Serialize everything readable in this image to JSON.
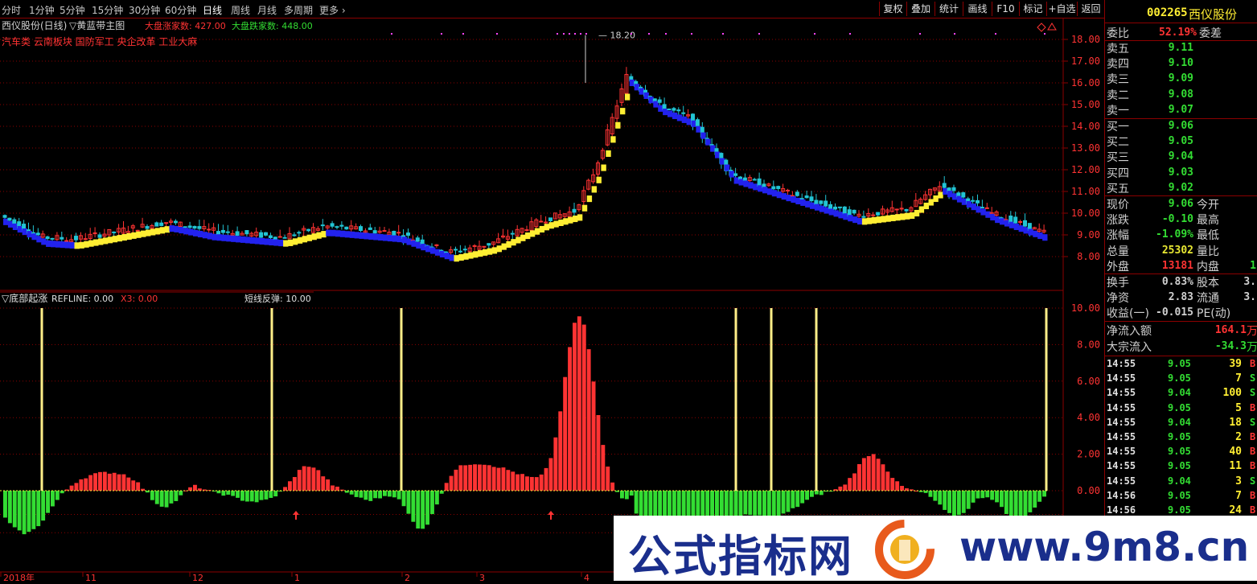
{
  "toolbar": {
    "periods": [
      "分时",
      "1分钟",
      "5分钟",
      "15分钟",
      "30分钟",
      "60分钟",
      "日线",
      "周线",
      "月线",
      "多周期",
      "更多"
    ],
    "active_period": "日线",
    "buttons": [
      "复权",
      "叠加",
      "统计",
      "画线",
      "F10",
      "标记",
      "+自选",
      "返回"
    ]
  },
  "main_panel": {
    "stock_label": "西仪股份(日线)",
    "indicator_label": "▽黄蓝带主图",
    "market_up_label": "大盘涨家数: 427.00",
    "market_down_label": "大盘跌家数: 448.00",
    "concepts": "汽车类 云南板块 国防军工 央企改革 工业大麻",
    "peak_label": "18.20",
    "y_ticks": [
      "18.00",
      "17.00",
      "16.00",
      "15.00",
      "14.00",
      "13.00",
      "12.00",
      "11.00",
      "10.00",
      "9.00",
      "8.00"
    ]
  },
  "sub_panel": {
    "name": "▽底部起涨",
    "refline": "REFLINE: 0.00",
    "x3": "X3: 0.00",
    "signal": "短线反弹: 10.00",
    "y_ticks": [
      "10.00",
      "8.00",
      "6.00",
      "4.00",
      "2.00",
      "0.00"
    ]
  },
  "x_axis": {
    "labels": [
      "2018年",
      "11",
      "12",
      "1",
      "2",
      "3",
      "4"
    ]
  },
  "quote": {
    "code": "002265",
    "name": "西仪股份",
    "weibi_label": "委比",
    "weibi_value": "52.19%",
    "weicha_label": "委差",
    "sell": [
      {
        "label": "卖五",
        "price": "9.11"
      },
      {
        "label": "卖四",
        "price": "9.10"
      },
      {
        "label": "卖三",
        "price": "9.09"
      },
      {
        "label": "卖二",
        "price": "9.08"
      },
      {
        "label": "卖一",
        "price": "9.07"
      }
    ],
    "buy": [
      {
        "label": "买一",
        "price": "9.06"
      },
      {
        "label": "买二",
        "price": "9.05"
      },
      {
        "label": "买三",
        "price": "9.04"
      },
      {
        "label": "买四",
        "price": "9.03"
      },
      {
        "label": "买五",
        "price": "9.02"
      }
    ],
    "stats": [
      {
        "label": "现价",
        "value": "9.06",
        "value_color": "#33dd33",
        "right": "今开"
      },
      {
        "label": "涨跌",
        "value": "-0.10",
        "value_color": "#33dd33",
        "right": "最高"
      },
      {
        "label": "涨幅",
        "value": "-1.09%",
        "value_color": "#33dd33",
        "right": "最低"
      },
      {
        "label": "总量",
        "value": "25302",
        "value_color": "#e8e833",
        "right": "量比"
      },
      {
        "label": "外盘",
        "value": "13181",
        "value_color": "#ff3333",
        "right": "内盘",
        "right_value": "1"
      }
    ],
    "stats2": [
      {
        "label": "换手",
        "value": "0.83%",
        "right": "股本",
        "right_value": "3."
      },
      {
        "label": "净资",
        "value": "2.83",
        "right": "流通",
        "right_value": "3."
      },
      {
        "label": "收益(一)",
        "value": "-0.015",
        "right": "PE(动)"
      }
    ],
    "flows": [
      {
        "label": "净流入额",
        "value": "164.1",
        "unit": "万",
        "color": "#ff3333"
      },
      {
        "label": "大宗流入",
        "value": "-34.3",
        "unit": "万",
        "color": "#33dd33"
      }
    ],
    "trades": [
      {
        "time": "14:55",
        "price": "9.05",
        "vol": "39",
        "side": "B"
      },
      {
        "time": "14:55",
        "price": "9.05",
        "vol": "7",
        "side": "S"
      },
      {
        "time": "14:55",
        "price": "9.04",
        "vol": "100",
        "side": "S"
      },
      {
        "time": "14:55",
        "price": "9.05",
        "vol": "5",
        "side": "B"
      },
      {
        "time": "14:55",
        "price": "9.04",
        "vol": "18",
        "side": "S"
      },
      {
        "time": "14:55",
        "price": "9.05",
        "vol": "2",
        "side": "B"
      },
      {
        "time": "14:55",
        "price": "9.05",
        "vol": "40",
        "side": "B"
      },
      {
        "time": "14:55",
        "price": "9.05",
        "vol": "11",
        "side": "B"
      },
      {
        "time": "14:55",
        "price": "9.04",
        "vol": "3",
        "side": "S"
      },
      {
        "time": "14:56",
        "price": "9.05",
        "vol": "7",
        "side": "B"
      },
      {
        "time": "14:56",
        "price": "9.05",
        "vol": "24",
        "side": "B"
      }
    ]
  },
  "watermark": {
    "text_cn": "公式指标网",
    "text_url": "www.9m8.cn"
  },
  "colors": {
    "up": "#ff3333",
    "down": "#33dd33",
    "yellow": "#ffee33",
    "blue": "#2222ee",
    "cyan": "#22c4d4",
    "grid": "#8b0000",
    "signal": "#ffee88"
  }
}
